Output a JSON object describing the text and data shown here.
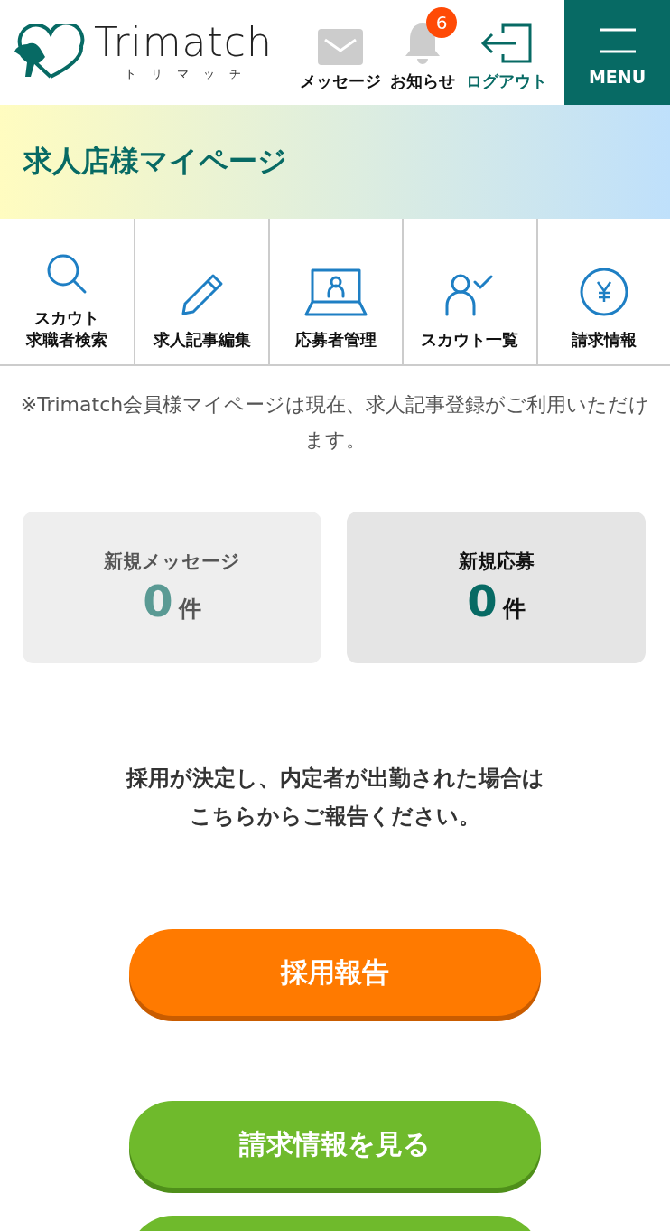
{
  "header": {
    "logo": {
      "name": "Trimatch",
      "reading": "トリマッチ"
    },
    "nav": [
      {
        "kind": "mail",
        "label": "メッセージ"
      },
      {
        "kind": "bell",
        "label": "お知らせ",
        "badge": "6"
      },
      {
        "kind": "logout",
        "label": "ログアウト"
      }
    ],
    "menu_button": {
      "label": "MENU"
    }
  },
  "page_title": "求人店様マイページ",
  "shortcuts": [
    {
      "kind": "search",
      "label": [
        "スカウト",
        "求職者検索"
      ]
    },
    {
      "kind": "pencil",
      "label": [
        "求人記事編集"
      ]
    },
    {
      "kind": "laptop",
      "label": [
        "応募者管理"
      ]
    },
    {
      "kind": "person-check",
      "label": [
        "スカウト一覧"
      ]
    },
    {
      "kind": "yen",
      "label": [
        "請求情報"
      ]
    }
  ],
  "notice": "※Trimatch会員様マイページは現在、求人記事登録がご利用いただけます。",
  "stats": [
    {
      "label": "新規メッセージ",
      "count": "0",
      "unit": "件",
      "dimmed": true
    },
    {
      "label": "新規応募",
      "count": "0",
      "unit": "件",
      "dimmed": false
    }
  ],
  "report_text": "採用が決定し、内定者が出勤された場合はこちらからご報告ください。",
  "buttons": [
    {
      "kind": "orange",
      "label": "採用報告"
    },
    {
      "kind": "green",
      "label": "請求情報を見る"
    },
    {
      "kind": "green"
    }
  ]
}
